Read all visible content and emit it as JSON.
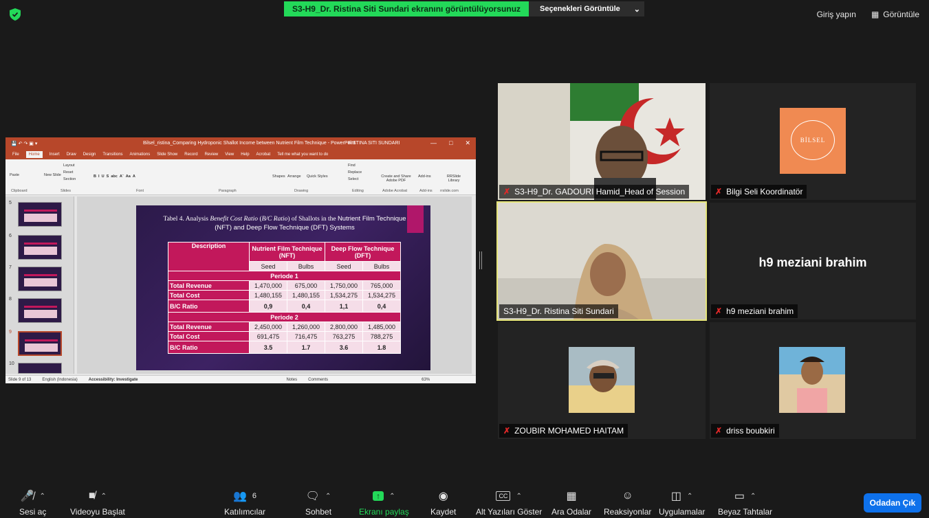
{
  "top": {
    "banner": "S3-H9_Dr. Ristina Siti Sundari ekranını görüntülüyorsunuz",
    "view_options": "Seçenekleri Görüntüle",
    "sign_in": "Giriş yapın",
    "view": "Görüntüle"
  },
  "ppt": {
    "title": "Bilsel_ristina_Comparing Hydroponic Shallot Income between Nutrient Film Technique  -  PowerPoint",
    "user": "RISTINA SITI SUNDARI",
    "tabs": [
      "File",
      "Home",
      "Insert",
      "Draw",
      "Design",
      "Transitions",
      "Animations",
      "Slide Show",
      "Record",
      "Review",
      "View",
      "Help",
      "Acrobat",
      "Tell me what you want to do"
    ],
    "ribbon_groups": [
      "Clipboard",
      "Slides",
      "Font",
      "Paragraph",
      "Drawing",
      "Editing",
      "Adobe Acrobat",
      "Add-ins",
      "rrslide.com"
    ],
    "ribbon_tools": [
      "Paste",
      "New Slide",
      "Layout",
      "Reset",
      "Section",
      "Shapes",
      "Arrange",
      "Quick Styles",
      "Find",
      "Replace",
      "Select",
      "Create and Share Adobe PDF",
      "Add-ins",
      "RRSlide Library"
    ],
    "slide_numbers": [
      "5",
      "6",
      "7",
      "8",
      "9",
      "10"
    ],
    "status": [
      "Slide 9 of 13",
      "English (Indonesia)",
      "Accessibility: Investigate",
      "Notes",
      "Comments",
      "63%"
    ]
  },
  "slide": {
    "caption_a": "Tabel 4. Analysis ",
    "caption_b": "Benefit Cost Ratio",
    "caption_c": " (",
    "caption_d": "B/C Ratio",
    "caption_e": ") of Shallots in the ",
    "caption_f": "Nutrient Film Technique (NFT) and Deep Flow Technique (DFT) Systems",
    "table": {
      "h_desc": "Description",
      "h_nft": "Nutrient Film Technique (NFT)",
      "h_dft": "Deep Flow Technique (DFT)",
      "sub": [
        "Seed",
        "Bulbs",
        "Seed",
        "Bulbs"
      ],
      "p1": "Periode 1",
      "p2": "Periode 2",
      "rows1": [
        {
          "label": "Total Revenue",
          "v": [
            "1,470,000",
            "675,000",
            "1,750,000",
            "765,000"
          ]
        },
        {
          "label": "Total Cost",
          "v": [
            "1,480,155",
            "1,480,155",
            "1,534,275",
            "1,534,275"
          ]
        },
        {
          "label": "B/C Ratio",
          "v": [
            "0,9",
            "0,4",
            "1,1",
            "0,4"
          ]
        }
      ],
      "rows2": [
        {
          "label": "Total Revenue",
          "v": [
            "2,450,000",
            "1,260,000",
            "2,800,000",
            "1,485,000"
          ]
        },
        {
          "label": "Total Cost",
          "v": [
            "691,475",
            "716,475",
            "763,275",
            "788,275"
          ]
        },
        {
          "label": "B/C Ratio",
          "v": [
            "3.5",
            "1.7",
            "3.6",
            "1.8"
          ]
        }
      ]
    }
  },
  "participants": [
    "S3-H9_Dr. GADOURI Hamid_Head of Session",
    "Bilgi Seli Koordinatör",
    "S3-H9_Dr. Ristina Siti Sundari",
    "h9 meziani brahim",
    "ZOUBIR MOHAMED HAITAM",
    "driss boubkiri"
  ],
  "logo_text": "BİLSEL",
  "toolbar": {
    "audio": "Sesi aç",
    "video": "Videoyu Başlat",
    "participants": "Katılımcılar",
    "participants_count": "6",
    "chat": "Sohbet",
    "share": "Ekranı paylaş",
    "record": "Kaydet",
    "captions": "Alt Yazıları Göster",
    "cc": "CC",
    "breakout": "Ara Odalar",
    "reactions": "Reaksiyonlar",
    "apps": "Uygulamalar",
    "whiteboard": "Beyaz Tahtalar",
    "leave": "Odadan Çık"
  },
  "colors": {
    "share_green": "#23d959",
    "leave_blue": "#0e71eb",
    "slide_pink": "#c2185b",
    "active_border": "#e6e57a"
  }
}
